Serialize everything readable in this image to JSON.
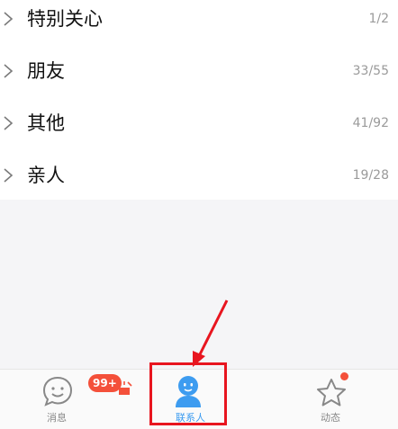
{
  "groups": [
    {
      "name": "特别关心",
      "count": "1/2"
    },
    {
      "name": "朋友",
      "count": "33/55"
    },
    {
      "name": "其他",
      "count": "41/92"
    },
    {
      "name": "亲人",
      "count": "19/28"
    }
  ],
  "nav": {
    "messages": {
      "label": "消息",
      "badge": "99+",
      "icon": "chat-face-icon"
    },
    "contacts": {
      "label": "联系人",
      "icon": "person-icon"
    },
    "feed": {
      "label": "动态",
      "icon": "star-icon"
    }
  },
  "colors": {
    "accent": "#3d9cf0",
    "badge": "#f4503a",
    "annotation": "#e8151f",
    "inactive": "#888888"
  }
}
